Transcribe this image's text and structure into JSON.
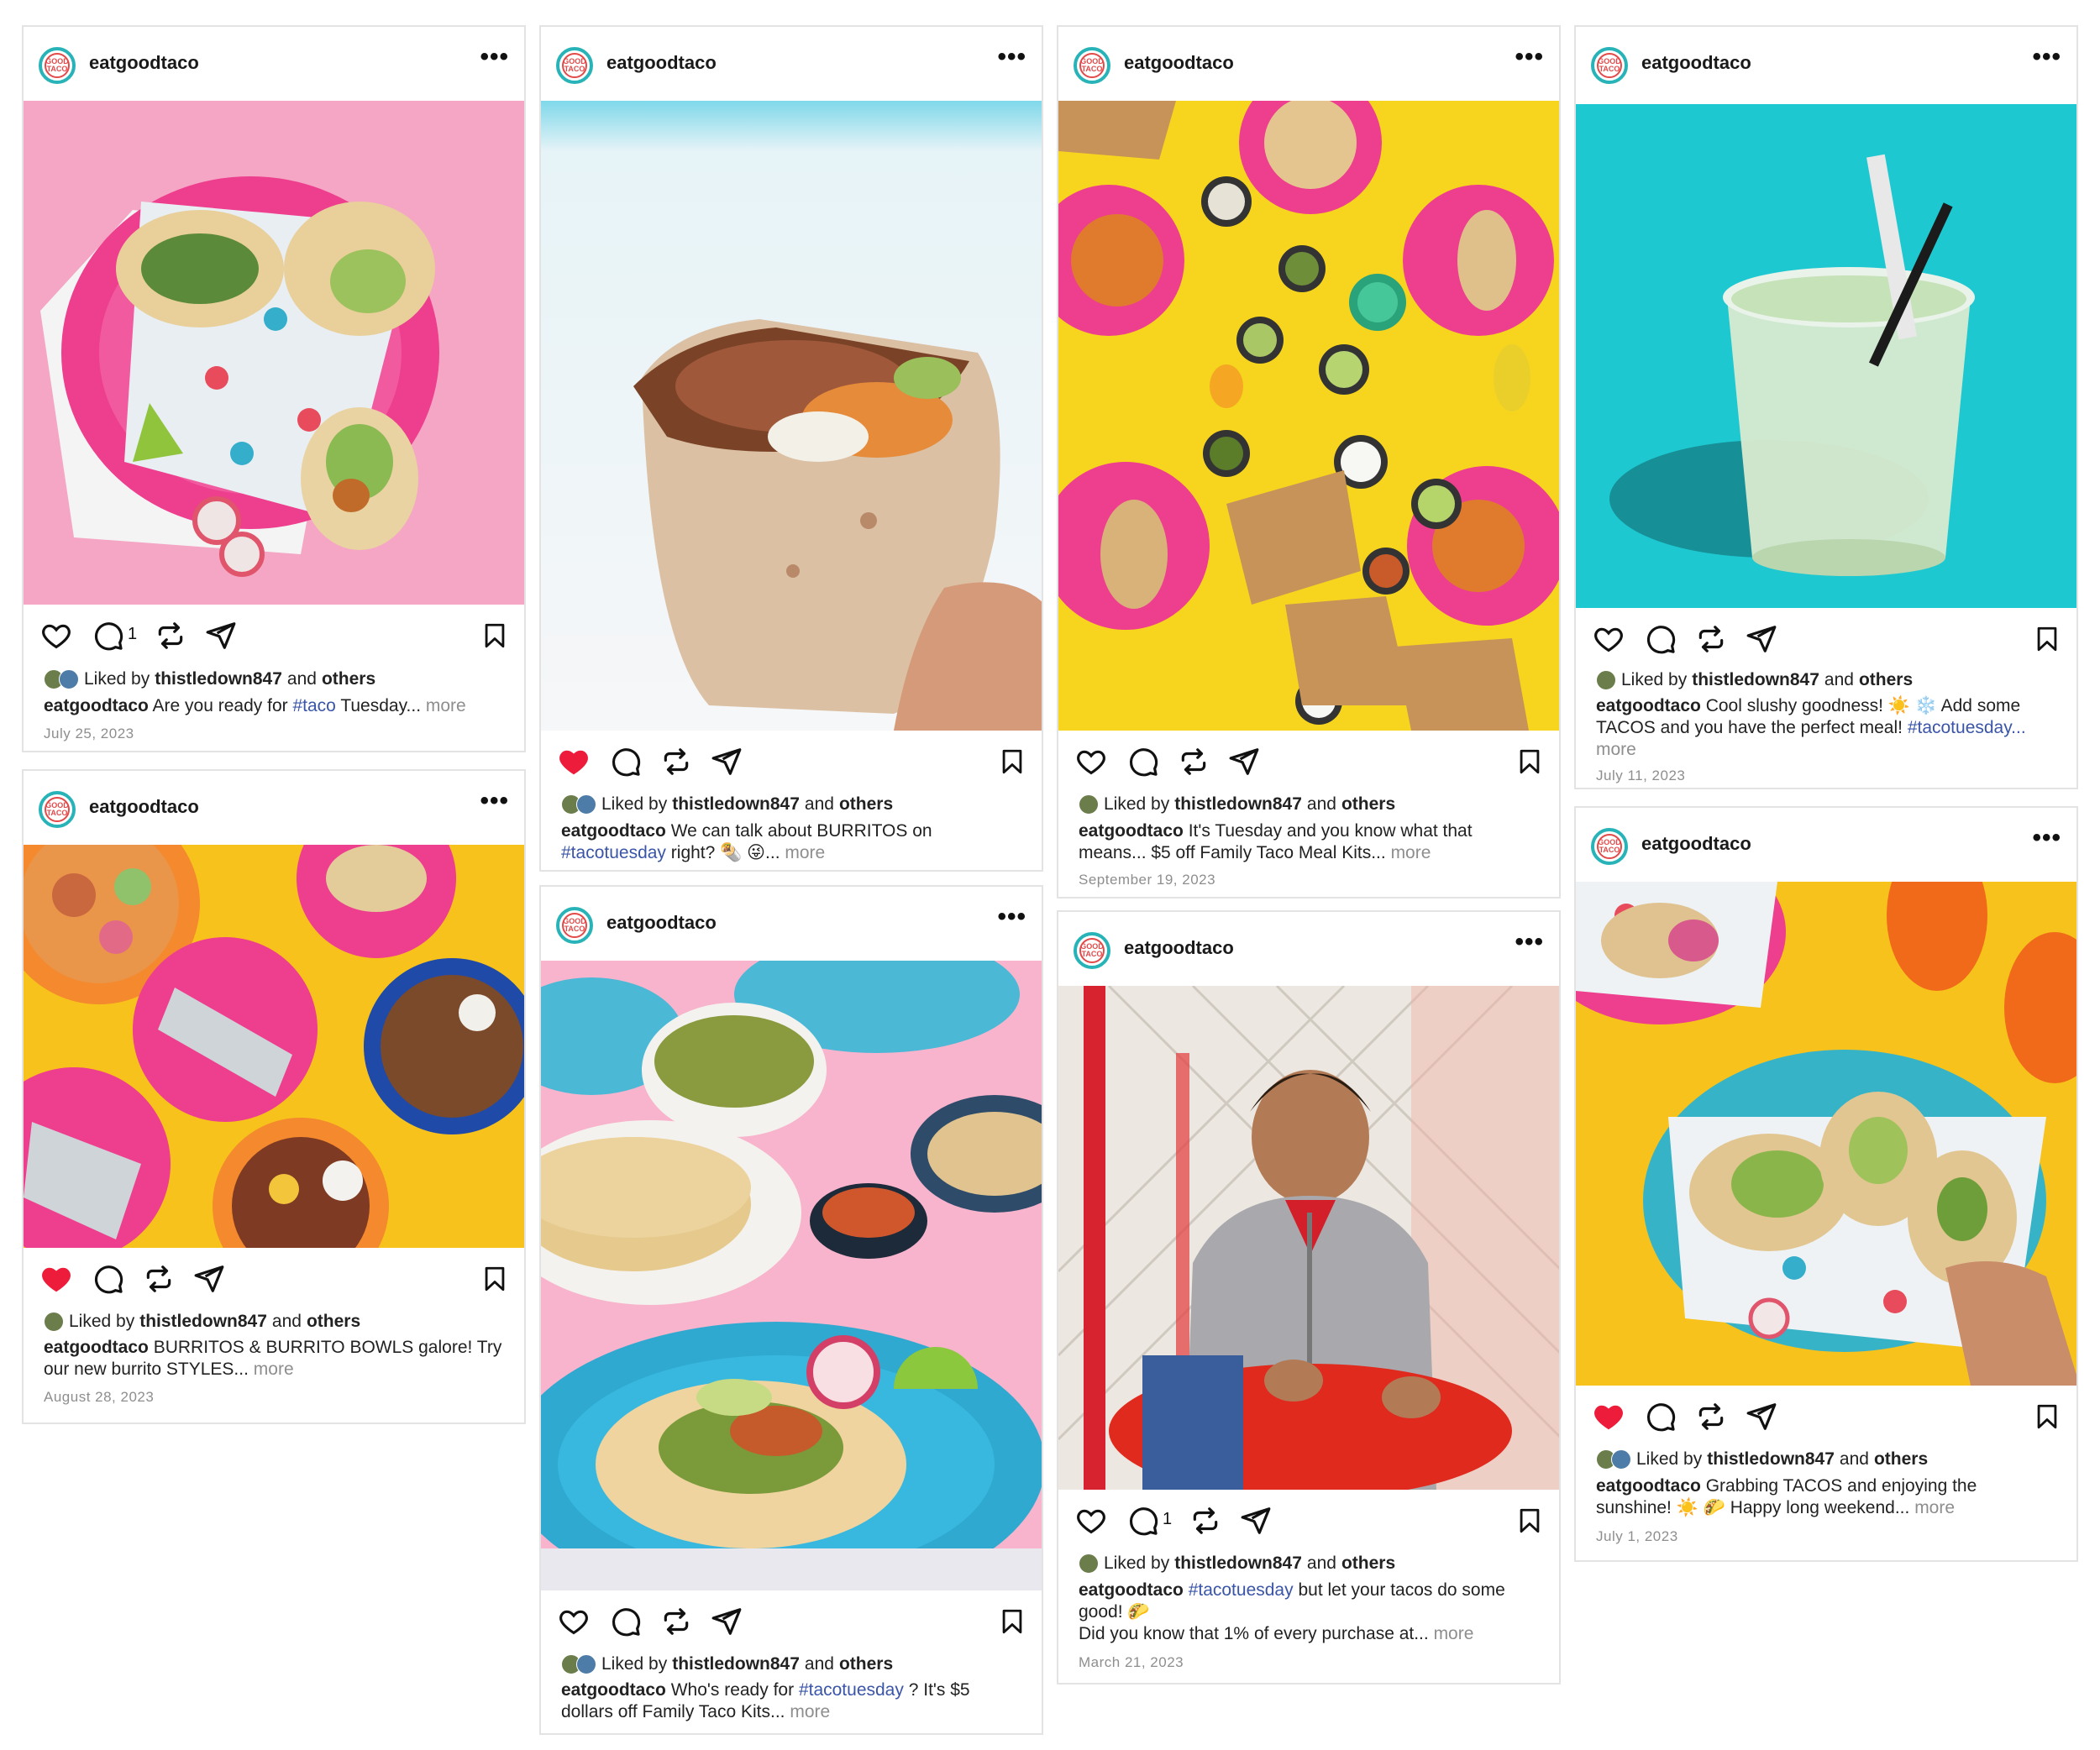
{
  "posts": [
    {
      "username": "eatgoodtaco",
      "avatar_text": "GOOD TACO",
      "liked_by_prefix": "Liked by",
      "liked_by_user": "thistledown847",
      "liked_by_and": "and",
      "liked_by_others": "others",
      "comment_count": "1",
      "liked": false,
      "caption_user": "eatgoodtaco",
      "caption_before": "Are you ready for",
      "caption_tag": "#taco",
      "caption_after": "Tuesday...",
      "more": "more",
      "date": "July 25, 2023"
    },
    {
      "username": "eatgoodtaco",
      "avatar_text": "GOOD TACO",
      "liked_by_prefix": "Liked by",
      "liked_by_user": "thistledown847",
      "liked_by_and": "and",
      "liked_by_others": "others",
      "liked": true,
      "caption_user": "eatgoodtaco",
      "caption_before": "We can talk about BURRITOS on",
      "caption_tag": "#tacotuesday",
      "caption_after": "right? 🌯 😜...",
      "more": "more"
    },
    {
      "username": "eatgoodtaco",
      "avatar_text": "GOOD TACO",
      "liked_by_prefix": "Liked by",
      "liked_by_user": "thistledown847",
      "liked_by_and": "and",
      "liked_by_others": "others",
      "liked": false,
      "caption_user": "eatgoodtaco",
      "caption_before": "It's Tuesday and you know what that means... $5 off Family Taco Meal Kits...",
      "more": "more",
      "date": "September 19, 2023"
    },
    {
      "username": "eatgoodtaco",
      "avatar_text": "GOOD TACO",
      "liked_by_prefix": "Liked by",
      "liked_by_user": "thistledown847",
      "liked_by_and": "and",
      "liked_by_others": "others",
      "liked": false,
      "caption_user": "eatgoodtaco",
      "caption_before": "Cool slushy goodness! ☀️ ❄️ Add some TACOS and you have the perfect meal!",
      "caption_tag": "#tacotuesday...",
      "more": "more",
      "date": "July 11, 2023"
    },
    {
      "username": "eatgoodtaco",
      "avatar_text": "GOOD TACO",
      "liked_by_prefix": "Liked by",
      "liked_by_user": "thistledown847",
      "liked_by_and": "and",
      "liked_by_others": "others",
      "liked": true,
      "caption_user": "eatgoodtaco",
      "caption_before": "BURRITOS & BURRITO BOWLS galore! Try our new burrito STYLES...",
      "more": "more",
      "date": "August 28, 2023"
    },
    {
      "username": "eatgoodtaco",
      "avatar_text": "GOOD TACO",
      "liked_by_prefix": "Liked by",
      "liked_by_user": "thistledown847",
      "liked_by_and": "and",
      "liked_by_others": "others",
      "liked": false,
      "caption_user": "eatgoodtaco",
      "caption_before": "Who's ready for",
      "caption_tag": "#tacotuesday",
      "caption_after": "? It's $5 dollars off Family Taco Kits...",
      "more": "more"
    },
    {
      "username": "eatgoodtaco",
      "avatar_text": "GOOD TACO",
      "liked_by_prefix": "Liked by",
      "liked_by_user": "thistledown847",
      "liked_by_and": "and",
      "liked_by_others": "others",
      "comment_count": "1",
      "liked": false,
      "caption_user": "eatgoodtaco",
      "caption_tag": "#tacotuesday",
      "caption_after": "but let your tacos do some good! 🌮",
      "caption_line2": "Did you know that 1% of every purchase at...",
      "more": "more",
      "date": "March 21, 2023"
    },
    {
      "username": "eatgoodtaco",
      "avatar_text": "GOOD TACO",
      "liked_by_prefix": "Liked by",
      "liked_by_user": "thistledown847",
      "liked_by_and": "and",
      "liked_by_others": "others",
      "liked": true,
      "caption_user": "eatgoodtaco",
      "caption_before": "Grabbing TACOS and enjoying the sunshine! ☀️ 🌮 Happy long weekend...",
      "more": "more",
      "date": "July 1, 2023"
    }
  ],
  "colors": {
    "like_red": "#ed1c3a",
    "hashtag_blue": "#3a55a8",
    "muted_gray": "#8e8e8e",
    "brand_teal": "#27b3b8",
    "brand_red": "#e24a4a"
  }
}
